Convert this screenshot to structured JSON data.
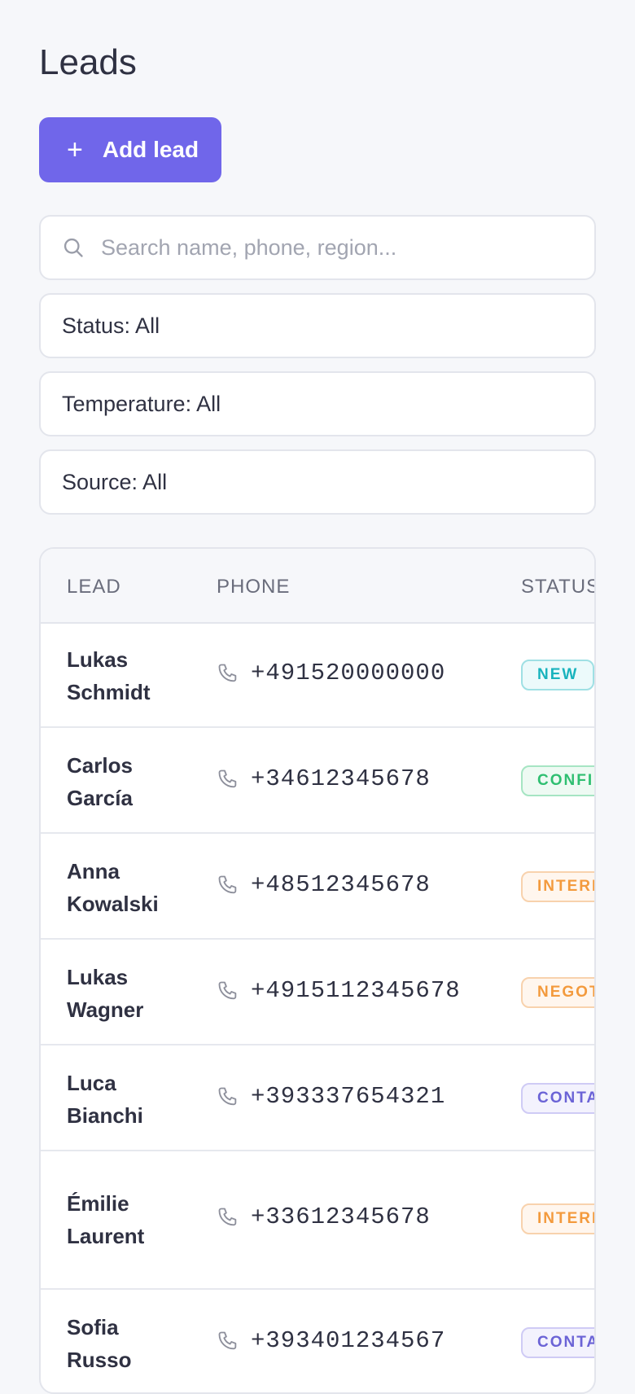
{
  "page": {
    "title": "Leads"
  },
  "actions": {
    "add_label": "Add lead"
  },
  "search": {
    "placeholder": "Search name, phone, region..."
  },
  "filters": {
    "status": "Status: All",
    "temperature": "Temperature: All",
    "source": "Source: All"
  },
  "table": {
    "columns": [
      "LEAD",
      "PHONE",
      "STATUS"
    ],
    "rows": [
      {
        "first": "Lukas",
        "last": "Schmidt",
        "phone": "+491520000000",
        "status": "NEW"
      },
      {
        "first": "Carlos",
        "last": "García",
        "phone": "+34612345678",
        "status": "CONFIR"
      },
      {
        "first": "Anna",
        "last": "Kowalski",
        "phone": "+48512345678",
        "status": "INTERE"
      },
      {
        "first": "Lukas",
        "last": "Wagner",
        "phone": "+4915112345678",
        "status": "NEGOT"
      },
      {
        "first": "Luca",
        "last": "Bianchi",
        "phone": "+393337654321",
        "status": "CONTA"
      },
      {
        "first": "Émilie",
        "last": "Laurent",
        "phone": "+33612345678",
        "status": "INTERE"
      },
      {
        "first": "Sofia",
        "last": "Russo",
        "phone": "+393401234567",
        "status": "CONTA"
      }
    ]
  },
  "colors": {
    "accent": "#7066ea",
    "status_new": "#18b3bd",
    "status_confirmed": "#2fbf71",
    "status_interested": "#f39a3d",
    "status_negotiating": "#f39a3d",
    "status_contacted": "#6b63d6"
  },
  "icons": {
    "search": "search-icon",
    "phone": "phone-icon",
    "add": "plus-icon"
  }
}
